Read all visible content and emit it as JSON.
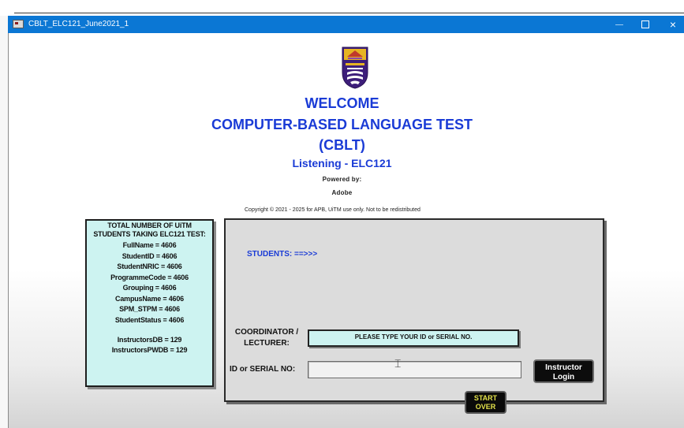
{
  "window": {
    "title": "CBLT_ELC121_June2021_1",
    "close_glyph": "×"
  },
  "header": {
    "welcome": "WELCOME",
    "title": "COMPUTER-BASED LANGUAGE TEST",
    "abbrev": "(CBLT)",
    "subtitle": "Listening - ELC121",
    "powered_by": "Powered by:",
    "vendor": "Adobe",
    "copyright": "Copyright © 2021 - 2025 for APB, UiTM use only. Not to be redistributed"
  },
  "stats": {
    "heading_line1": "TOTAL NUMBER OF UiTM",
    "heading_line2": "STUDENTS TAKING ELC121 TEST:",
    "items": [
      "FullName = 4606",
      "StudentID = 4606",
      "StudentNRIC = 4606",
      "ProgrammeCode = 4606",
      "Grouping = 4606",
      "CampusName = 4606",
      "SPM_STPM = 4606",
      "StudentStatus = 4606"
    ],
    "instructors": [
      "InstructorsDB = 129",
      "InstructorsPWDB = 129"
    ]
  },
  "form": {
    "students_label": "STUDENTS: ==>>>",
    "coordinator_line1": "COORDINATOR /",
    "coordinator_line2": "LECTURER:",
    "coordinator_prompt": "PLEASE TYPE YOUR ID or SERIAL NO.",
    "id_label": "ID or SERIAL NO:",
    "id_value": "",
    "id_placeholder": "",
    "instructor_btn_line1": "Instructor",
    "instructor_btn_line2": "Login",
    "start_btn_line1": "START",
    "start_btn_line2": "OVER"
  },
  "colors": {
    "titlebar": "#0b77d4",
    "heading_blue": "#1a3bd6",
    "stats_panel": "#cdf3f1",
    "start_text": "#e4e34a",
    "logo_purple": "#3d1e7a",
    "logo_gold": "#e6b422"
  },
  "icons": {
    "app": "app-window-icon",
    "logo": "uitm-crest-logo",
    "cursor": "text-ibeam-cursor"
  }
}
